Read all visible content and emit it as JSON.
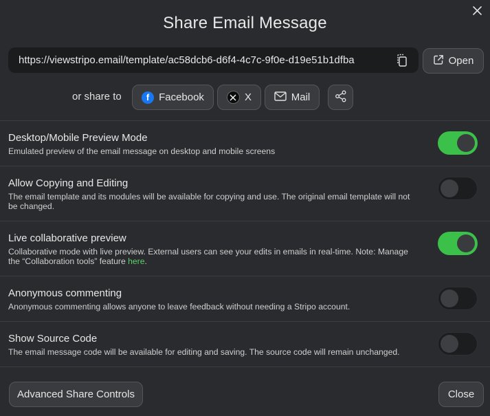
{
  "dialog": {
    "title": "Share Email Message",
    "share_url": "https://viewstripo.email/template/ac58dcb6-d6f4-4c7c-9f0e-d19e51b1dfba",
    "open_label": "Open",
    "share_to_label": "or share to",
    "facebook_label": "Facebook",
    "x_label": "X",
    "mail_label": "Mail",
    "advanced_label": "Advanced Share Controls",
    "close_label": "Close"
  },
  "settings": [
    {
      "title": "Desktop/Mobile Preview Mode",
      "desc": "Emulated preview of the email message on desktop and mobile screens",
      "enabled": true
    },
    {
      "title": "Allow Copying and Editing",
      "desc": "The email template and its modules will be available for copying and use. The original email template will not be changed.",
      "enabled": false
    },
    {
      "title": "Live collaborative preview",
      "desc_prefix": "Collaborative mode with live preview. External users can see your edits in emails in real-time. Note: Manage the “Collaboration tools” feature ",
      "desc_link": "here",
      "desc_suffix": ".",
      "enabled": true
    },
    {
      "title": "Anonymous commenting",
      "desc": "Anonymous commenting allows anyone to leave feedback without needing a Stripo account.",
      "enabled": false
    },
    {
      "title": "Show Source Code",
      "desc": "The email message code will be available for editing and saving. The source code will remain unchanged.",
      "enabled": false
    }
  ],
  "colors": {
    "background": "#2a2b2e",
    "toggle_on": "#3bc14a",
    "link": "#5fcf6b",
    "facebook": "#1877f2"
  },
  "icons": [
    "close-icon",
    "copy-icon",
    "external-link-icon",
    "facebook-icon",
    "x-logo-icon",
    "mail-icon",
    "share-icon"
  ]
}
